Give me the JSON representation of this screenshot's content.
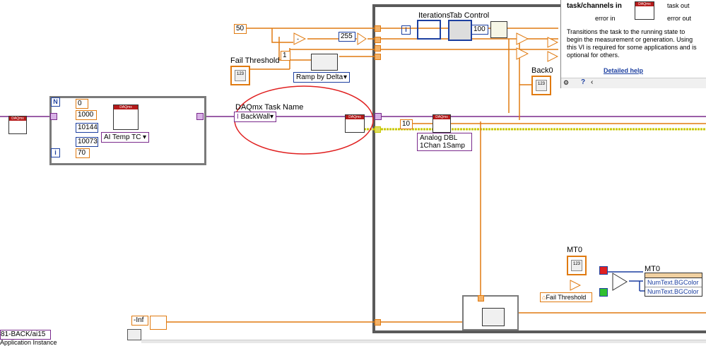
{
  "labels": {
    "fail_threshold": "Fail Threshold",
    "iterations": "Iterations",
    "tab_control": "Tab Control",
    "daqmx_task_name": "DAQmx Task Name",
    "back0": "Back0",
    "mt0_a": "MT0",
    "mt0_b": "MT0",
    "fail_threshold_ref": "Fail Threshold"
  },
  "constants": {
    "c50": "50",
    "c255": "255",
    "c1": "1",
    "c0": "0",
    "c1000": "1000",
    "c10144": "10144",
    "c10073": "10073",
    "c70": "70",
    "c100": "100",
    "c10": "10",
    "neg_inf": "-Inf"
  },
  "rings": {
    "ramp": "Ramp by Delta",
    "ai_temp": "AI Temp TC",
    "backwall": "BackWall",
    "analog_dbl_1": "Analog DBL",
    "analog_dbl_2": "1Chan 1Samp"
  },
  "property_node": {
    "prop1": "NumText.BGColor",
    "prop2": "NumText.BGColor"
  },
  "bottom": {
    "channel_ref": "81-BACK/ai15",
    "app_instance": "Application Instance"
  },
  "help": {
    "title": "task/channels in",
    "task_out": "task out",
    "error_in": "error in",
    "error_out": "error out",
    "body": "Transitions the task to the running state to begin the measurement or generation. Using this VI is required for some applications and is optional for others.",
    "link": "Detailed help"
  },
  "glyphs": {
    "n": "N",
    "i": "i",
    "daqmx": "DAQmx"
  },
  "colors": {
    "wire_orange": "#e07a10",
    "wire_blue": "#1c3fa0",
    "wire_purple": "#7a2a8c",
    "wire_yellow": "#c8c800",
    "annotation_red": "#e02020"
  }
}
